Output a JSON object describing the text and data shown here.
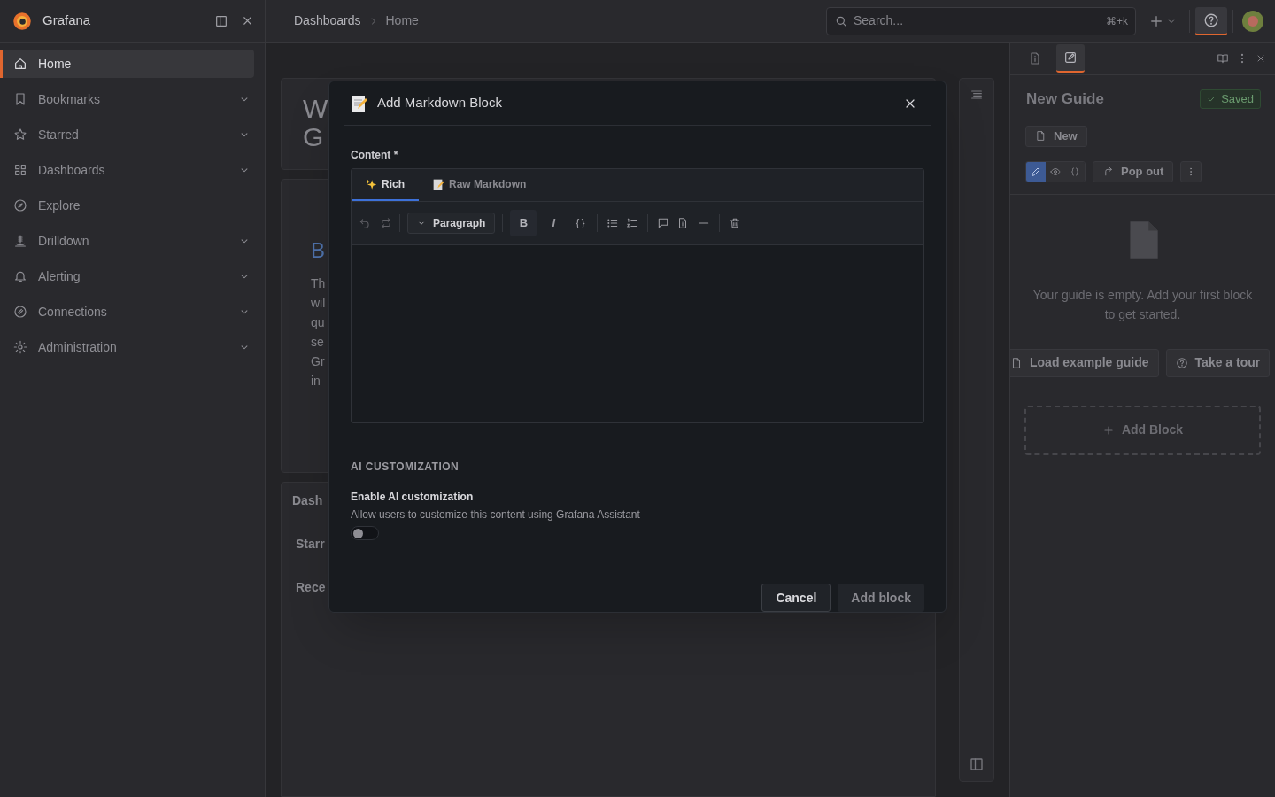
{
  "top_bar": {
    "brand": "Grafana",
    "breadcrumbs": [
      "Dashboards",
      "Home"
    ],
    "search": {
      "placeholder": "Search...",
      "shortcut": "⌘+k"
    },
    "help_selected": true
  },
  "nav": [
    {
      "label": "Home",
      "selected": true,
      "expandable": false
    },
    {
      "label": "Bookmarks",
      "selected": false,
      "expandable": true
    },
    {
      "label": "Starred",
      "selected": false,
      "expandable": true
    },
    {
      "label": "Dashboards",
      "selected": false,
      "expandable": true
    },
    {
      "label": "Explore",
      "selected": false,
      "expandable": false
    },
    {
      "label": "Drilldown",
      "selected": false,
      "expandable": true
    },
    {
      "label": "Alerting",
      "selected": false,
      "expandable": true
    },
    {
      "label": "Connections",
      "selected": false,
      "expandable": true
    },
    {
      "label": "Administration",
      "selected": false,
      "expandable": true
    }
  ],
  "dashboard": {
    "title_lines": [
      "W",
      "G"
    ],
    "section_heading": "B",
    "paragraph_lines": [
      "Th",
      "wil",
      "qu",
      "se",
      "Gr",
      "in"
    ],
    "list_heading": "Dash",
    "list_items": [
      "Starr",
      "Rece"
    ]
  },
  "modal": {
    "title": "Add Markdown Block",
    "content_label": "Content *",
    "tabs": [
      {
        "label": "Rich",
        "selected": true
      },
      {
        "label": "Raw Markdown",
        "selected": false
      }
    ],
    "block_type": "Paragraph",
    "format_buttons": [
      {
        "label": "B",
        "selected": true
      },
      {
        "label": "I",
        "selected": false
      }
    ],
    "section_heading": "AI CUSTOMIZATION",
    "toggle": {
      "label": "Enable AI customization",
      "description": "Allow users to customize this content using Grafana Assistant",
      "on": false
    },
    "buttons": [
      {
        "label": "Cancel",
        "kind": "secondary"
      },
      {
        "label": "Add block",
        "kind": "primary"
      }
    ]
  },
  "guide_panel": {
    "tabs": [
      {
        "selected": false
      },
      {
        "selected": true
      }
    ],
    "title": "New Guide",
    "status": "Saved",
    "new_button": "New",
    "modes": [
      {
        "selected": true
      },
      {
        "selected": false
      },
      {
        "selected": false
      }
    ],
    "pop_out": "Pop out",
    "empty_message": "Your guide is empty. Add your first block to get started.",
    "actions": [
      "Load example guide",
      "Take a tour"
    ],
    "add_block": "Add Block"
  }
}
